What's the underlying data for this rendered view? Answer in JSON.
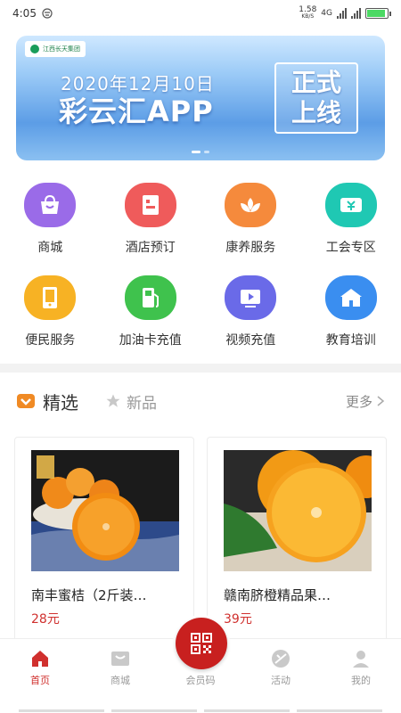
{
  "status_bar": {
    "time": "4:05",
    "net_speed": "1.58",
    "net_unit": "KB/S",
    "net_type": "4G",
    "battery_level": 0.9
  },
  "banner": {
    "logo_text": "江西长天集团",
    "date": "2020年12月10日",
    "title": "彩云汇APP",
    "badge_line1": "正式",
    "badge_line2": "上线"
  },
  "categories": [
    {
      "label": "商城",
      "icon": "shop-bag-icon",
      "color": "#9a6be8"
    },
    {
      "label": "酒店预订",
      "icon": "hotel-icon",
      "color": "#ef5b5b"
    },
    {
      "label": "康养服务",
      "icon": "lotus-icon",
      "color": "#f58a3c"
    },
    {
      "label": "工会专区",
      "icon": "ticket-icon",
      "color": "#1fc8b3"
    },
    {
      "label": "便民服务",
      "icon": "tablet-icon",
      "color": "#f7b224"
    },
    {
      "label": "加油卡充值",
      "icon": "fuel-pump-icon",
      "color": "#3fc24d"
    },
    {
      "label": "视频充值",
      "icon": "video-play-icon",
      "color": "#6a6ae8"
    },
    {
      "label": "教育培训",
      "icon": "school-icon",
      "color": "#3a8ef0"
    }
  ],
  "section": {
    "selected_label": "精选",
    "new_label": "新品",
    "more_label": "更多",
    "accent": "#f08a24"
  },
  "products": [
    {
      "name": "南丰蜜桔（2斤装…",
      "price": "28元"
    },
    {
      "name": "赣南脐橙精品果…",
      "price": "39元"
    }
  ],
  "bottom_nav": {
    "items": [
      {
        "label": "首页",
        "icon": "home-icon",
        "active": true
      },
      {
        "label": "商城",
        "icon": "shop-icon",
        "active": false
      },
      {
        "label": "会员码",
        "icon": "qr-code-icon",
        "active": false
      },
      {
        "label": "活动",
        "icon": "activity-icon",
        "active": false
      },
      {
        "label": "我的",
        "icon": "profile-icon",
        "active": false
      }
    ],
    "active_color": "#d0302e"
  }
}
